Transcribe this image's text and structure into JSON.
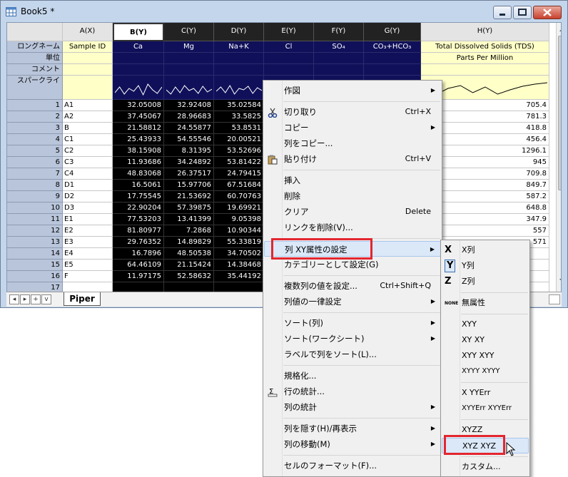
{
  "window": {
    "title": "Book5 *"
  },
  "columns": [
    {
      "key": "A",
      "header": "A(X)",
      "long_name": "Sample ID",
      "units": "",
      "selected": false
    },
    {
      "key": "B",
      "header": "B(Y)",
      "long_name": "Ca",
      "units": "",
      "selected": true
    },
    {
      "key": "C",
      "header": "C(Y)",
      "long_name": "Mg",
      "units": "",
      "selected": true
    },
    {
      "key": "D",
      "header": "D(Y)",
      "long_name": "Na+K",
      "units": "",
      "selected": true
    },
    {
      "key": "E",
      "header": "E(Y)",
      "long_name": "Cl",
      "units": "",
      "selected": true
    },
    {
      "key": "F",
      "header": "F(Y)",
      "long_name": "SO₄",
      "units": "",
      "selected": true
    },
    {
      "key": "G",
      "header": "G(Y)",
      "long_name": "CO₃+HCO₃",
      "units": "",
      "selected": true
    },
    {
      "key": "H",
      "header": "H(Y)",
      "long_name": "Total Dissolved Solids (TDS)",
      "units": "Parts Per Million",
      "selected": false
    }
  ],
  "row_labels": {
    "long_name": "ロングネーム",
    "units": "単位",
    "comment": "コメント",
    "sparkline": "スパークライ"
  },
  "rows": [
    {
      "n": "1",
      "A": "A1",
      "B": "32.05008",
      "C": "32.92408",
      "D": "35.02584",
      "H": "705.4"
    },
    {
      "n": "2",
      "A": "A2",
      "B": "37.45067",
      "C": "28.96683",
      "D": "33.5825",
      "H": "781.3"
    },
    {
      "n": "3",
      "A": "B",
      "B": "21.58812",
      "C": "24.55877",
      "D": "53.8531",
      "H": "418.8"
    },
    {
      "n": "4",
      "A": "C1",
      "B": "25.43933",
      "C": "54.55546",
      "D": "20.00521",
      "H": "456.4"
    },
    {
      "n": "5",
      "A": "C2",
      "B": "38.15908",
      "C": "8.31395",
      "D": "53.52696",
      "H": "1296.1"
    },
    {
      "n": "6",
      "A": "C3",
      "B": "11.93686",
      "C": "34.24892",
      "D": "53.81422",
      "H": "945"
    },
    {
      "n": "7",
      "A": "C4",
      "B": "48.83068",
      "C": "26.37517",
      "D": "24.79415",
      "H": "709.8"
    },
    {
      "n": "8",
      "A": "D1",
      "B": "16.5061",
      "C": "15.97706",
      "D": "67.51684",
      "H": "849.7"
    },
    {
      "n": "9",
      "A": "D2",
      "B": "17.75545",
      "C": "21.53692",
      "D": "60.70763",
      "H": "587.2"
    },
    {
      "n": "10",
      "A": "D3",
      "B": "22.90204",
      "C": "57.39875",
      "D": "19.69921",
      "H": "648.8"
    },
    {
      "n": "11",
      "A": "E1",
      "B": "77.53203",
      "C": "13.41399",
      "D": "9.05398",
      "H": "347.9"
    },
    {
      "n": "12",
      "A": "E2",
      "B": "81.80977",
      "C": "7.2868",
      "D": "10.90344",
      "H": "557"
    },
    {
      "n": "13",
      "A": "E3",
      "B": "29.76352",
      "C": "14.89829",
      "D": "55.33819",
      "H": "571"
    },
    {
      "n": "14",
      "A": "E4",
      "B": "16.7896",
      "C": "48.50538",
      "D": "34.70502",
      "H": ""
    },
    {
      "n": "15",
      "A": "E5",
      "B": "64.46109",
      "C": "21.15424",
      "D": "14.38468",
      "H": ""
    },
    {
      "n": "16",
      "A": "F",
      "B": "11.97175",
      "C": "52.58632",
      "D": "35.44192",
      "H": ""
    },
    {
      "n": "17",
      "A": "",
      "B": "",
      "C": "",
      "D": "",
      "H": ""
    }
  ],
  "sheet_tab": "Piper",
  "context_menu": {
    "items": [
      {
        "label": "作図",
        "shortcut": "",
        "submenu": true,
        "icon": ""
      },
      {
        "sep": true
      },
      {
        "label": "切り取り",
        "shortcut": "Ctrl+X",
        "submenu": false,
        "icon": "scissors-icon"
      },
      {
        "label": "コピー",
        "shortcut": "",
        "submenu": true,
        "icon": ""
      },
      {
        "label": "列をコピー...",
        "shortcut": "",
        "submenu": false,
        "icon": ""
      },
      {
        "label": "貼り付け",
        "shortcut": "Ctrl+V",
        "submenu": false,
        "icon": "paste-icon"
      },
      {
        "sep": true
      },
      {
        "label": "挿入",
        "shortcut": "",
        "submenu": false,
        "icon": ""
      },
      {
        "label": "削除",
        "shortcut": "",
        "submenu": false,
        "icon": ""
      },
      {
        "label": "クリア",
        "shortcut": "Delete",
        "submenu": false,
        "icon": ""
      },
      {
        "label": "リンクを削除(V)...",
        "shortcut": "",
        "submenu": false,
        "icon": ""
      },
      {
        "sep": true
      },
      {
        "label": "列 XY属性の設定",
        "shortcut": "",
        "submenu": true,
        "icon": "",
        "highlight": true
      },
      {
        "label": "カテゴリーとして設定(G)",
        "shortcut": "",
        "submenu": false,
        "icon": ""
      },
      {
        "sep": true
      },
      {
        "label": "複数列の値を設定...",
        "shortcut": "Ctrl+Shift+Q",
        "submenu": false,
        "icon": ""
      },
      {
        "label": "列値の一律設定",
        "shortcut": "",
        "submenu": true,
        "icon": ""
      },
      {
        "sep": true
      },
      {
        "label": "ソート(列)",
        "shortcut": "",
        "submenu": true,
        "icon": ""
      },
      {
        "label": "ソート(ワークシート)",
        "shortcut": "",
        "submenu": true,
        "icon": ""
      },
      {
        "label": "ラベルで列をソート(L)...",
        "shortcut": "",
        "submenu": false,
        "icon": ""
      },
      {
        "sep": true
      },
      {
        "label": "規格化...",
        "shortcut": "",
        "submenu": false,
        "icon": ""
      },
      {
        "label": "行の統計...",
        "shortcut": "",
        "submenu": false,
        "icon": "sigma-icon"
      },
      {
        "label": "列の統計",
        "shortcut": "",
        "submenu": true,
        "icon": ""
      },
      {
        "sep": true
      },
      {
        "label": "列を隠す(H)/再表示",
        "shortcut": "",
        "submenu": true,
        "icon": ""
      },
      {
        "label": "列の移動(M)",
        "shortcut": "",
        "submenu": true,
        "icon": ""
      },
      {
        "sep": true
      },
      {
        "label": "セルのフォーマット(F)...",
        "shortcut": "",
        "submenu": false,
        "icon": ""
      }
    ]
  },
  "submenu": {
    "items": [
      {
        "label": "X列",
        "icon": "X"
      },
      {
        "label": "Y列",
        "icon": "Y"
      },
      {
        "label": "Z列",
        "icon": "Z"
      },
      {
        "sep": true
      },
      {
        "label": "無属性",
        "icon": "NONE"
      },
      {
        "sep": true
      },
      {
        "label": "XYY",
        "icon": ""
      },
      {
        "label": "XY XY",
        "icon": ""
      },
      {
        "label": "XYY XYY",
        "icon": ""
      },
      {
        "label": "XYYY XYYY",
        "icon": ""
      },
      {
        "sep": true
      },
      {
        "label": "X YYErr",
        "icon": ""
      },
      {
        "label": "XYYErr XYYErr",
        "icon": ""
      },
      {
        "sep": true
      },
      {
        "label": "XYZZ",
        "icon": ""
      },
      {
        "label": "XYZ XYZ",
        "icon": "",
        "highlight": true
      },
      {
        "sep": true
      },
      {
        "label": "カスタム...",
        "icon": ""
      }
    ]
  }
}
